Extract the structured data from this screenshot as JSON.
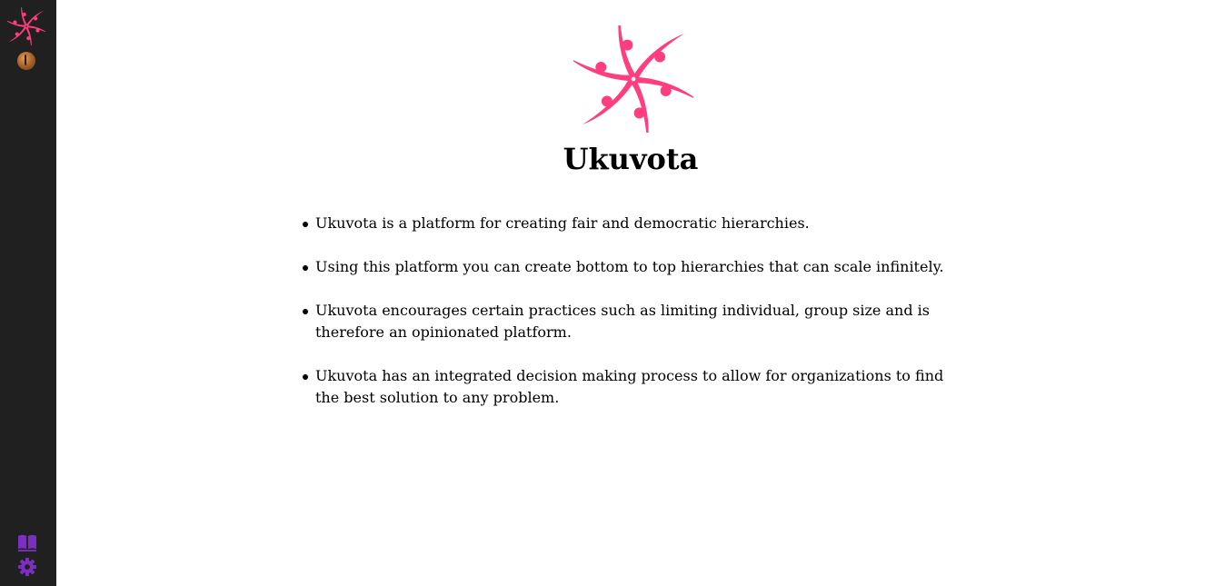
{
  "app": {
    "title": "Ukuvota",
    "accent_color": "#ff3d7f",
    "sidebar_icon_color": "#7b2fbe"
  },
  "sidebar": {
    "logo_icon": "ukuvota-logo-icon",
    "avatar_icon": "user-avatar-icon",
    "docs_icon": "book-open-icon",
    "settings_icon": "gear-icon"
  },
  "main": {
    "title": "Ukuvota",
    "bullets": [
      "Ukuvota is a platform for creating fair and democratic hierarchies.",
      "Using this platform you can create bottom to top hierarchies that can scale infinitely.",
      "Ukuvota encourages certain practices such as limiting individual, group size and is therefore an opinionated platform.",
      "Ukuvota has an integrated decision making process to allow for organizations to find the best solution to any problem."
    ]
  }
}
